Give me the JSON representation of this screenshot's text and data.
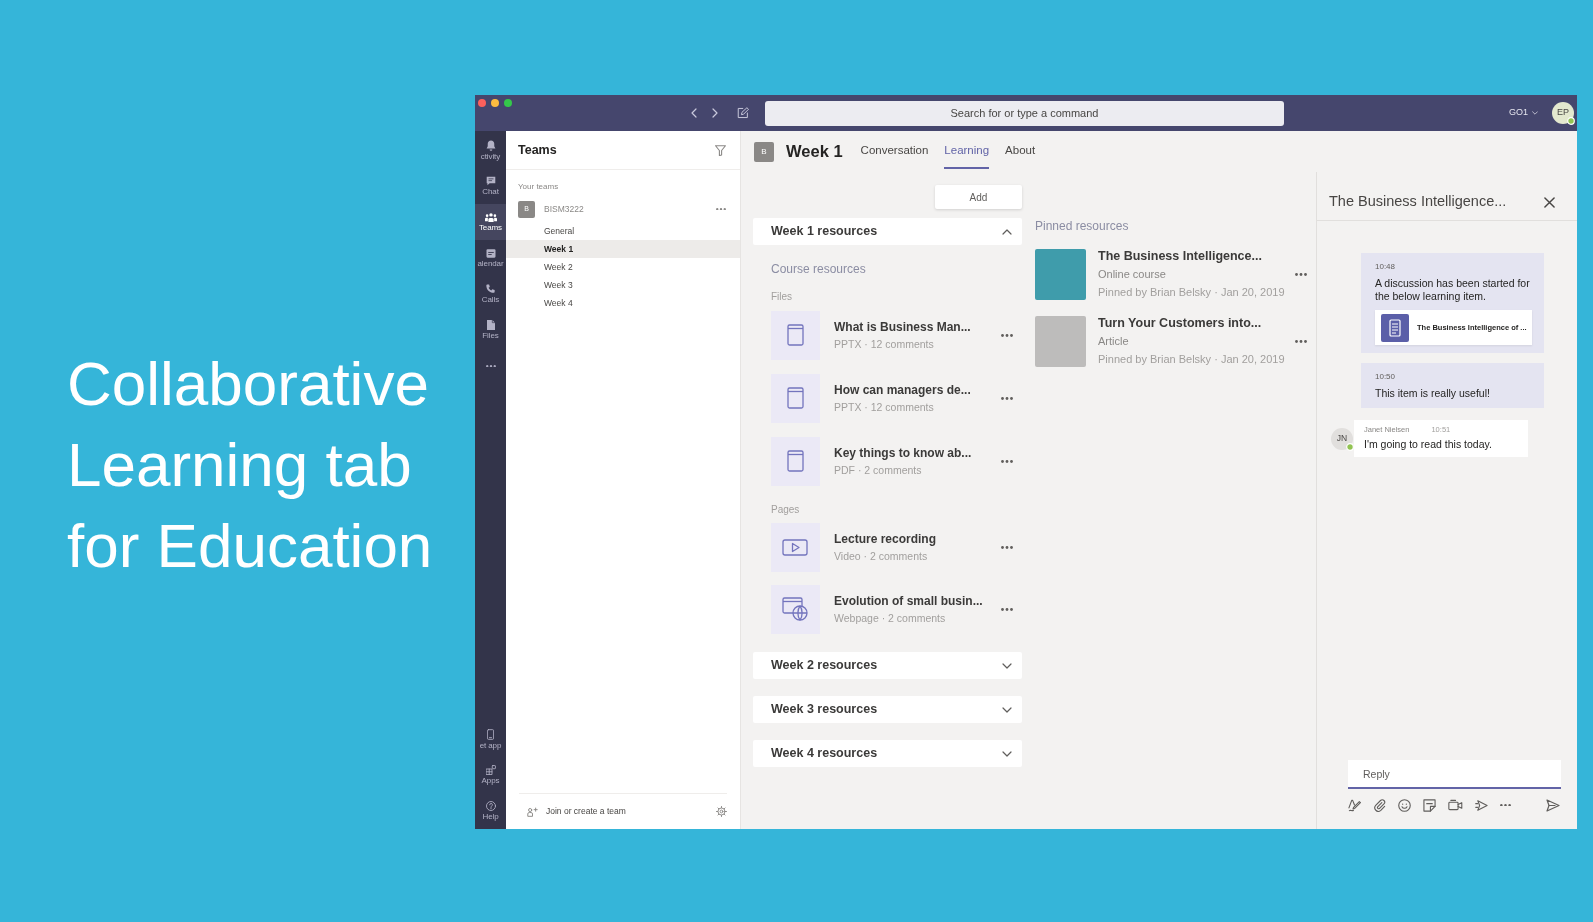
{
  "headline": "Collaborative Learning tab for Education",
  "title_bar": {
    "search_placeholder": "Search for or type a command",
    "org": "GO1",
    "avatar": {
      "initials": "EP",
      "online": true
    }
  },
  "app_bar": {
    "items": [
      {
        "kind": "activity",
        "label": "ctivity",
        "selected": false
      },
      {
        "kind": "chat",
        "label": "Chat",
        "selected": false
      },
      {
        "kind": "teams",
        "label": "Teams",
        "selected": true
      },
      {
        "kind": "calendar",
        "label": "alendar",
        "selected": false
      },
      {
        "kind": "calls",
        "label": "Calls",
        "selected": false
      },
      {
        "kind": "files",
        "label": "Files",
        "selected": false
      }
    ],
    "bottom_items": [
      {
        "kind": "get_app",
        "label": "et app",
        "selected": false
      },
      {
        "kind": "apps",
        "label": "Apps",
        "selected": false
      },
      {
        "kind": "help",
        "label": "Help",
        "selected": false
      }
    ]
  },
  "teams_panel": {
    "title": "Teams",
    "section_label": "Your teams",
    "teams": [
      {
        "avatar": "B",
        "name": "BISM3222",
        "channels": [
          {
            "name": "General",
            "selected": false
          },
          {
            "name": "Week 1",
            "selected": true
          },
          {
            "name": "Week 2",
            "selected": false
          },
          {
            "name": "Week 3",
            "selected": false
          },
          {
            "name": "Week 4",
            "selected": false
          }
        ]
      }
    ],
    "footer": "Join or create a team"
  },
  "channel_header": {
    "avatar": "B",
    "title": "Week 1",
    "tabs": [
      {
        "label": "Conversation",
        "selected": false
      },
      {
        "label": "Learning",
        "selected": true
      },
      {
        "label": "About",
        "selected": false
      }
    ]
  },
  "learning": {
    "add_button": "Add",
    "sections": [
      {
        "title": "Week 1 resources",
        "expanded": true,
        "heading": "Course resources",
        "groups": [
          {
            "label": "Files",
            "items": [
              {
                "kind": "file",
                "title": "What is Business Man...",
                "meta": "PPTX · 12 comments"
              },
              {
                "kind": "file",
                "title": "How can managers de...",
                "meta": "PPTX · 12 comments"
              },
              {
                "kind": "file",
                "title": "Key things to know ab...",
                "meta": "PDF · 2 comments"
              }
            ]
          },
          {
            "label": "Pages",
            "items": [
              {
                "kind": "video",
                "title": "Lecture recording",
                "meta": "Video · 2 comments"
              },
              {
                "kind": "webpage",
                "title": "Evolution of small busin...",
                "meta": "Webpage · 2 comments"
              }
            ]
          }
        ]
      },
      {
        "title": "Week 2 resources",
        "expanded": false
      },
      {
        "title": "Week 3 resources",
        "expanded": false
      },
      {
        "title": "Week 4 resources",
        "expanded": false
      }
    ]
  },
  "pinned": {
    "title": "Pinned resources",
    "items": [
      {
        "kind": "illustration",
        "title": "The Business Intelligence...",
        "type": "Online course",
        "meta": "Pinned by Brian Belsky · Jan 20, 2019"
      },
      {
        "kind": "photo",
        "title": "Turn Your Customers into...",
        "type": "Article",
        "meta": "Pinned by Brian Belsky · Jan 20, 2019"
      }
    ]
  },
  "discussion": {
    "title": "The Business Intelligence...",
    "messages": [
      {
        "kind": "system",
        "time": "10:48",
        "text": "A discussion has been started for the below learning item.",
        "attachment": "The Business Intelligence of ..."
      },
      {
        "kind": "system",
        "time": "10:50",
        "text": "This item is really useful!"
      },
      {
        "kind": "reply",
        "author": "Janet Nielsen",
        "initials": "JN",
        "online": true,
        "time": "10:51",
        "text": "I'm going to read this today."
      }
    ],
    "reply_placeholder": "Reply"
  }
}
